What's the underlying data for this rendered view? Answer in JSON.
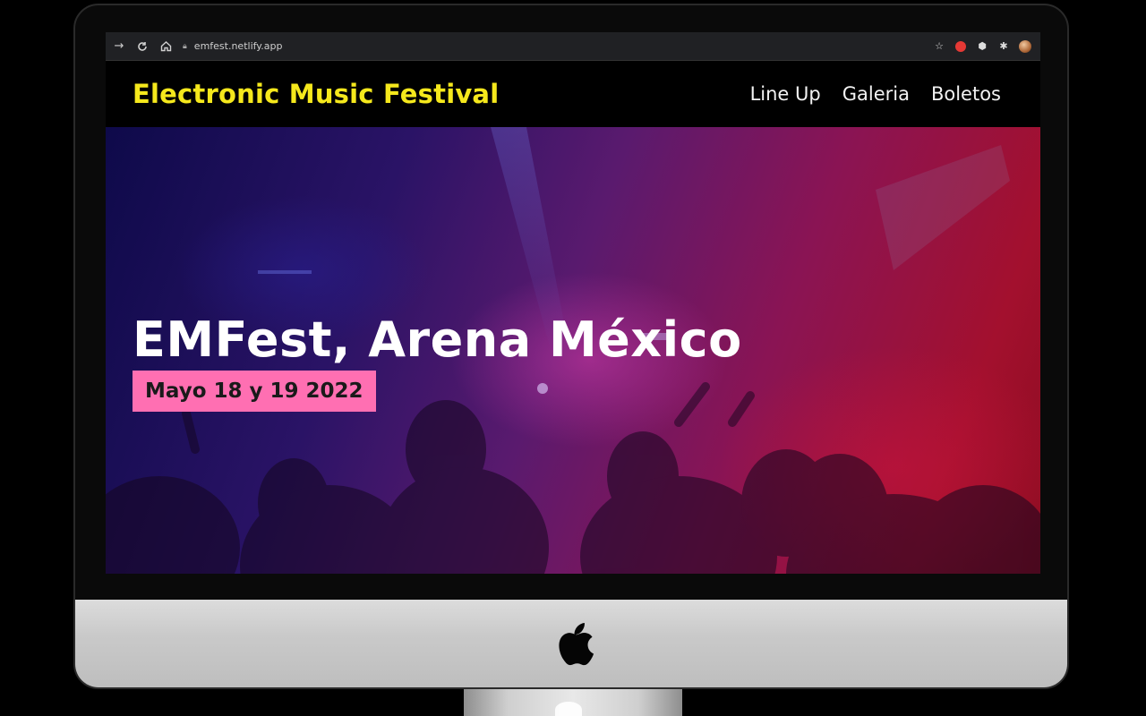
{
  "browser": {
    "url": "emfest.netlify.app",
    "back_icon": "arrow-right-icon",
    "reload_icon": "reload-icon",
    "home_icon": "home-icon",
    "lock_icon": "lock-icon",
    "star_icon": "star-icon",
    "extensions": [
      "red-extension-icon",
      "cube-extension-icon",
      "puzzle-icon",
      "profile-avatar"
    ]
  },
  "site": {
    "brand": "Electronic Music Festival",
    "brand_color": "#f5e81c",
    "nav": [
      "Line Up",
      "Galeria",
      "Boletos"
    ]
  },
  "hero": {
    "title": "EMFest, Arena México",
    "date": "Mayo 18 y 19 2022",
    "badge_color": "#ff6fb2"
  },
  "device": {
    "logo_icon": "apple-logo-icon"
  }
}
